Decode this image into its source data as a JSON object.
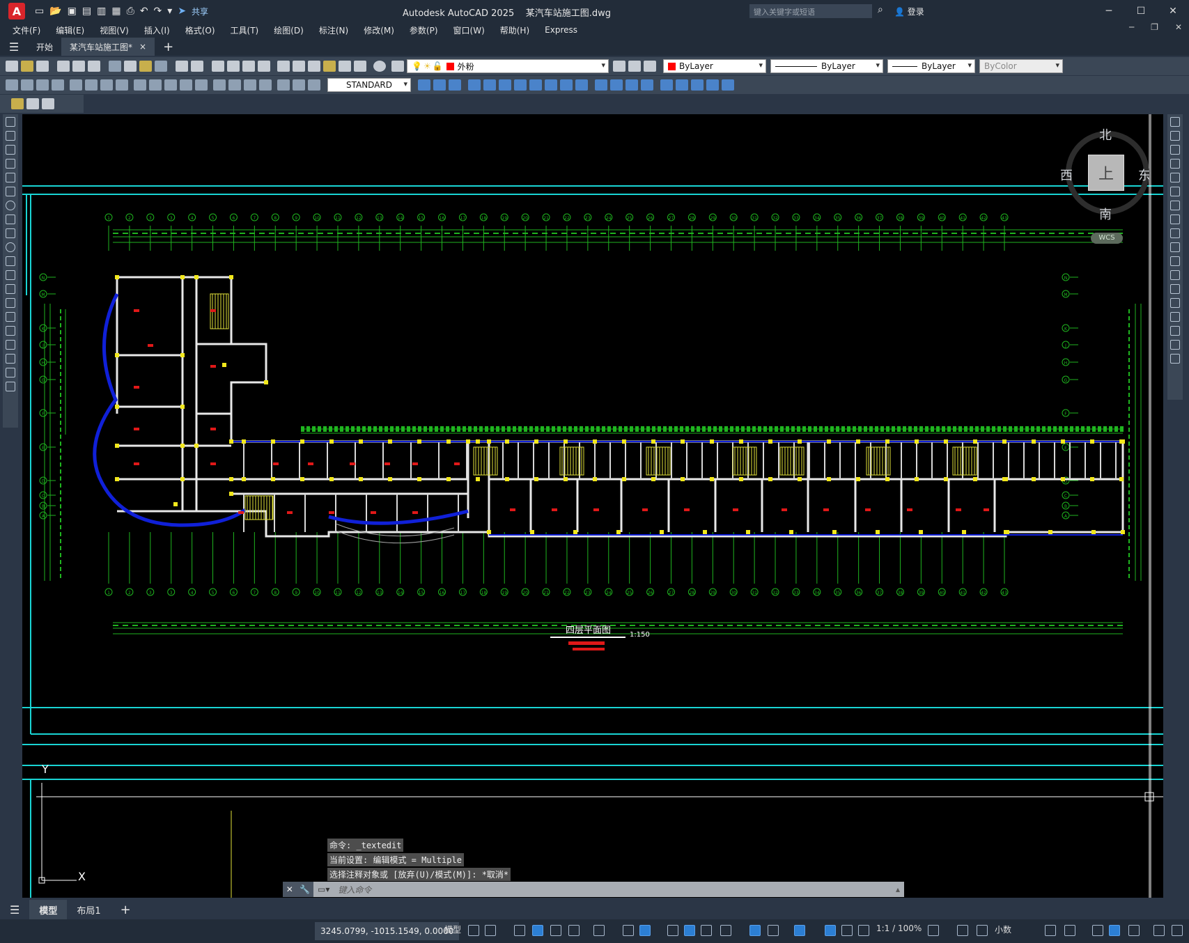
{
  "app": {
    "title": "Autodesk AutoCAD 2025",
    "file": "某汽车站施工图.dwg",
    "logo_letter": "A"
  },
  "quick_access": {
    "share": "共享"
  },
  "search": {
    "placeholder": "键入关键字或短语"
  },
  "account": {
    "login": "登录"
  },
  "window_controls": {
    "minimize": "─",
    "maximize": "☐",
    "close": "✕"
  },
  "menu": {
    "items": [
      "文件(F)",
      "编辑(E)",
      "视图(V)",
      "插入(I)",
      "格式(O)",
      "工具(T)",
      "绘图(D)",
      "标注(N)",
      "修改(M)",
      "参数(P)",
      "窗口(W)",
      "帮助(H)",
      "Express"
    ]
  },
  "tabs": {
    "start": "开始",
    "doc": "某汽车站施工图*",
    "close": "×",
    "add": "+"
  },
  "toolbar": {
    "layer": "外粉",
    "color": "ByLayer",
    "linetype": "ByLayer",
    "lineweight": "ByLayer",
    "plotstyle": "ByColor",
    "textstyle": "STANDARD"
  },
  "viewcube": {
    "north": "北",
    "south": "南",
    "east": "东",
    "west": "西",
    "face": "上",
    "wcs": "WCS"
  },
  "drawing": {
    "title": "四层平面图",
    "scale": "1:150",
    "axes_top": [
      "1",
      "2",
      "3",
      "3",
      "4",
      "5",
      "6",
      "7",
      "8",
      "9",
      "10",
      "11",
      "12",
      "13",
      "14",
      "15",
      "16",
      "17",
      "18",
      "19",
      "20",
      "21",
      "22",
      "23",
      "24",
      "25",
      "26",
      "27",
      "28",
      "29",
      "30",
      "31",
      "32",
      "33",
      "34",
      "35",
      "36",
      "37",
      "38",
      "39",
      "40",
      "41",
      "42",
      "43"
    ],
    "axes_left": [
      "N",
      "M",
      "K",
      "J",
      "H",
      "G",
      "F",
      "E",
      "D",
      "C",
      "B",
      "A"
    ],
    "ucs_x": "X",
    "ucs_y": "Y"
  },
  "command": {
    "history": [
      "命令: _textedit",
      "当前设置: 编辑模式 = Multiple",
      "选择注释对象或 [放弃(U)/模式(M)]: *取消*"
    ],
    "placeholder": "键入命令"
  },
  "layout_tabs": {
    "model": "模型",
    "layout1": "布局1",
    "add": "+"
  },
  "status": {
    "coords": "3245.0799, -1015.1549, 0.0000",
    "model": "模型",
    "annoscale": "1:1 / 100%",
    "units": "小数"
  }
}
